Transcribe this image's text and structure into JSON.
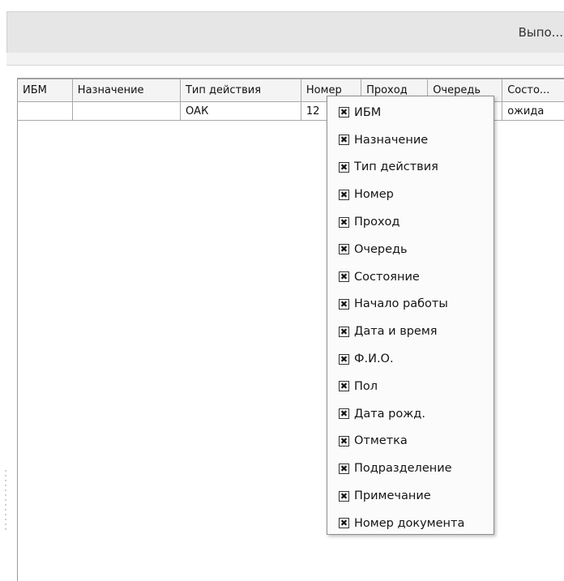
{
  "window": {
    "title": "Выпо..."
  },
  "table": {
    "columns": [
      "ИБМ",
      "Назначение",
      "Тип действия",
      "Номер",
      "Проход",
      "Очередь",
      "Состо..."
    ],
    "rows": [
      [
        "",
        "",
        "ОАК",
        "12",
        "",
        "",
        "ожида"
      ]
    ]
  },
  "column_menu": {
    "check_glyph": "✖",
    "items": [
      {
        "label": "ИБМ",
        "checked": true
      },
      {
        "label": "Назначение",
        "checked": true
      },
      {
        "label": "Тип действия",
        "checked": true
      },
      {
        "label": "Номер",
        "checked": true
      },
      {
        "label": "Проход",
        "checked": true
      },
      {
        "label": "Очередь",
        "checked": true
      },
      {
        "label": "Состояние",
        "checked": true
      },
      {
        "label": "Начало работы",
        "checked": true
      },
      {
        "label": "Дата и время",
        "checked": true
      },
      {
        "label": "Ф.И.О.",
        "checked": true
      },
      {
        "label": "Пол",
        "checked": true
      },
      {
        "label": "Дата рожд.",
        "checked": true
      },
      {
        "label": "Отметка",
        "checked": true
      },
      {
        "label": "Подразделение",
        "checked": true
      },
      {
        "label": "Примечание",
        "checked": true
      },
      {
        "label": "Номер документа",
        "checked": true
      }
    ]
  }
}
